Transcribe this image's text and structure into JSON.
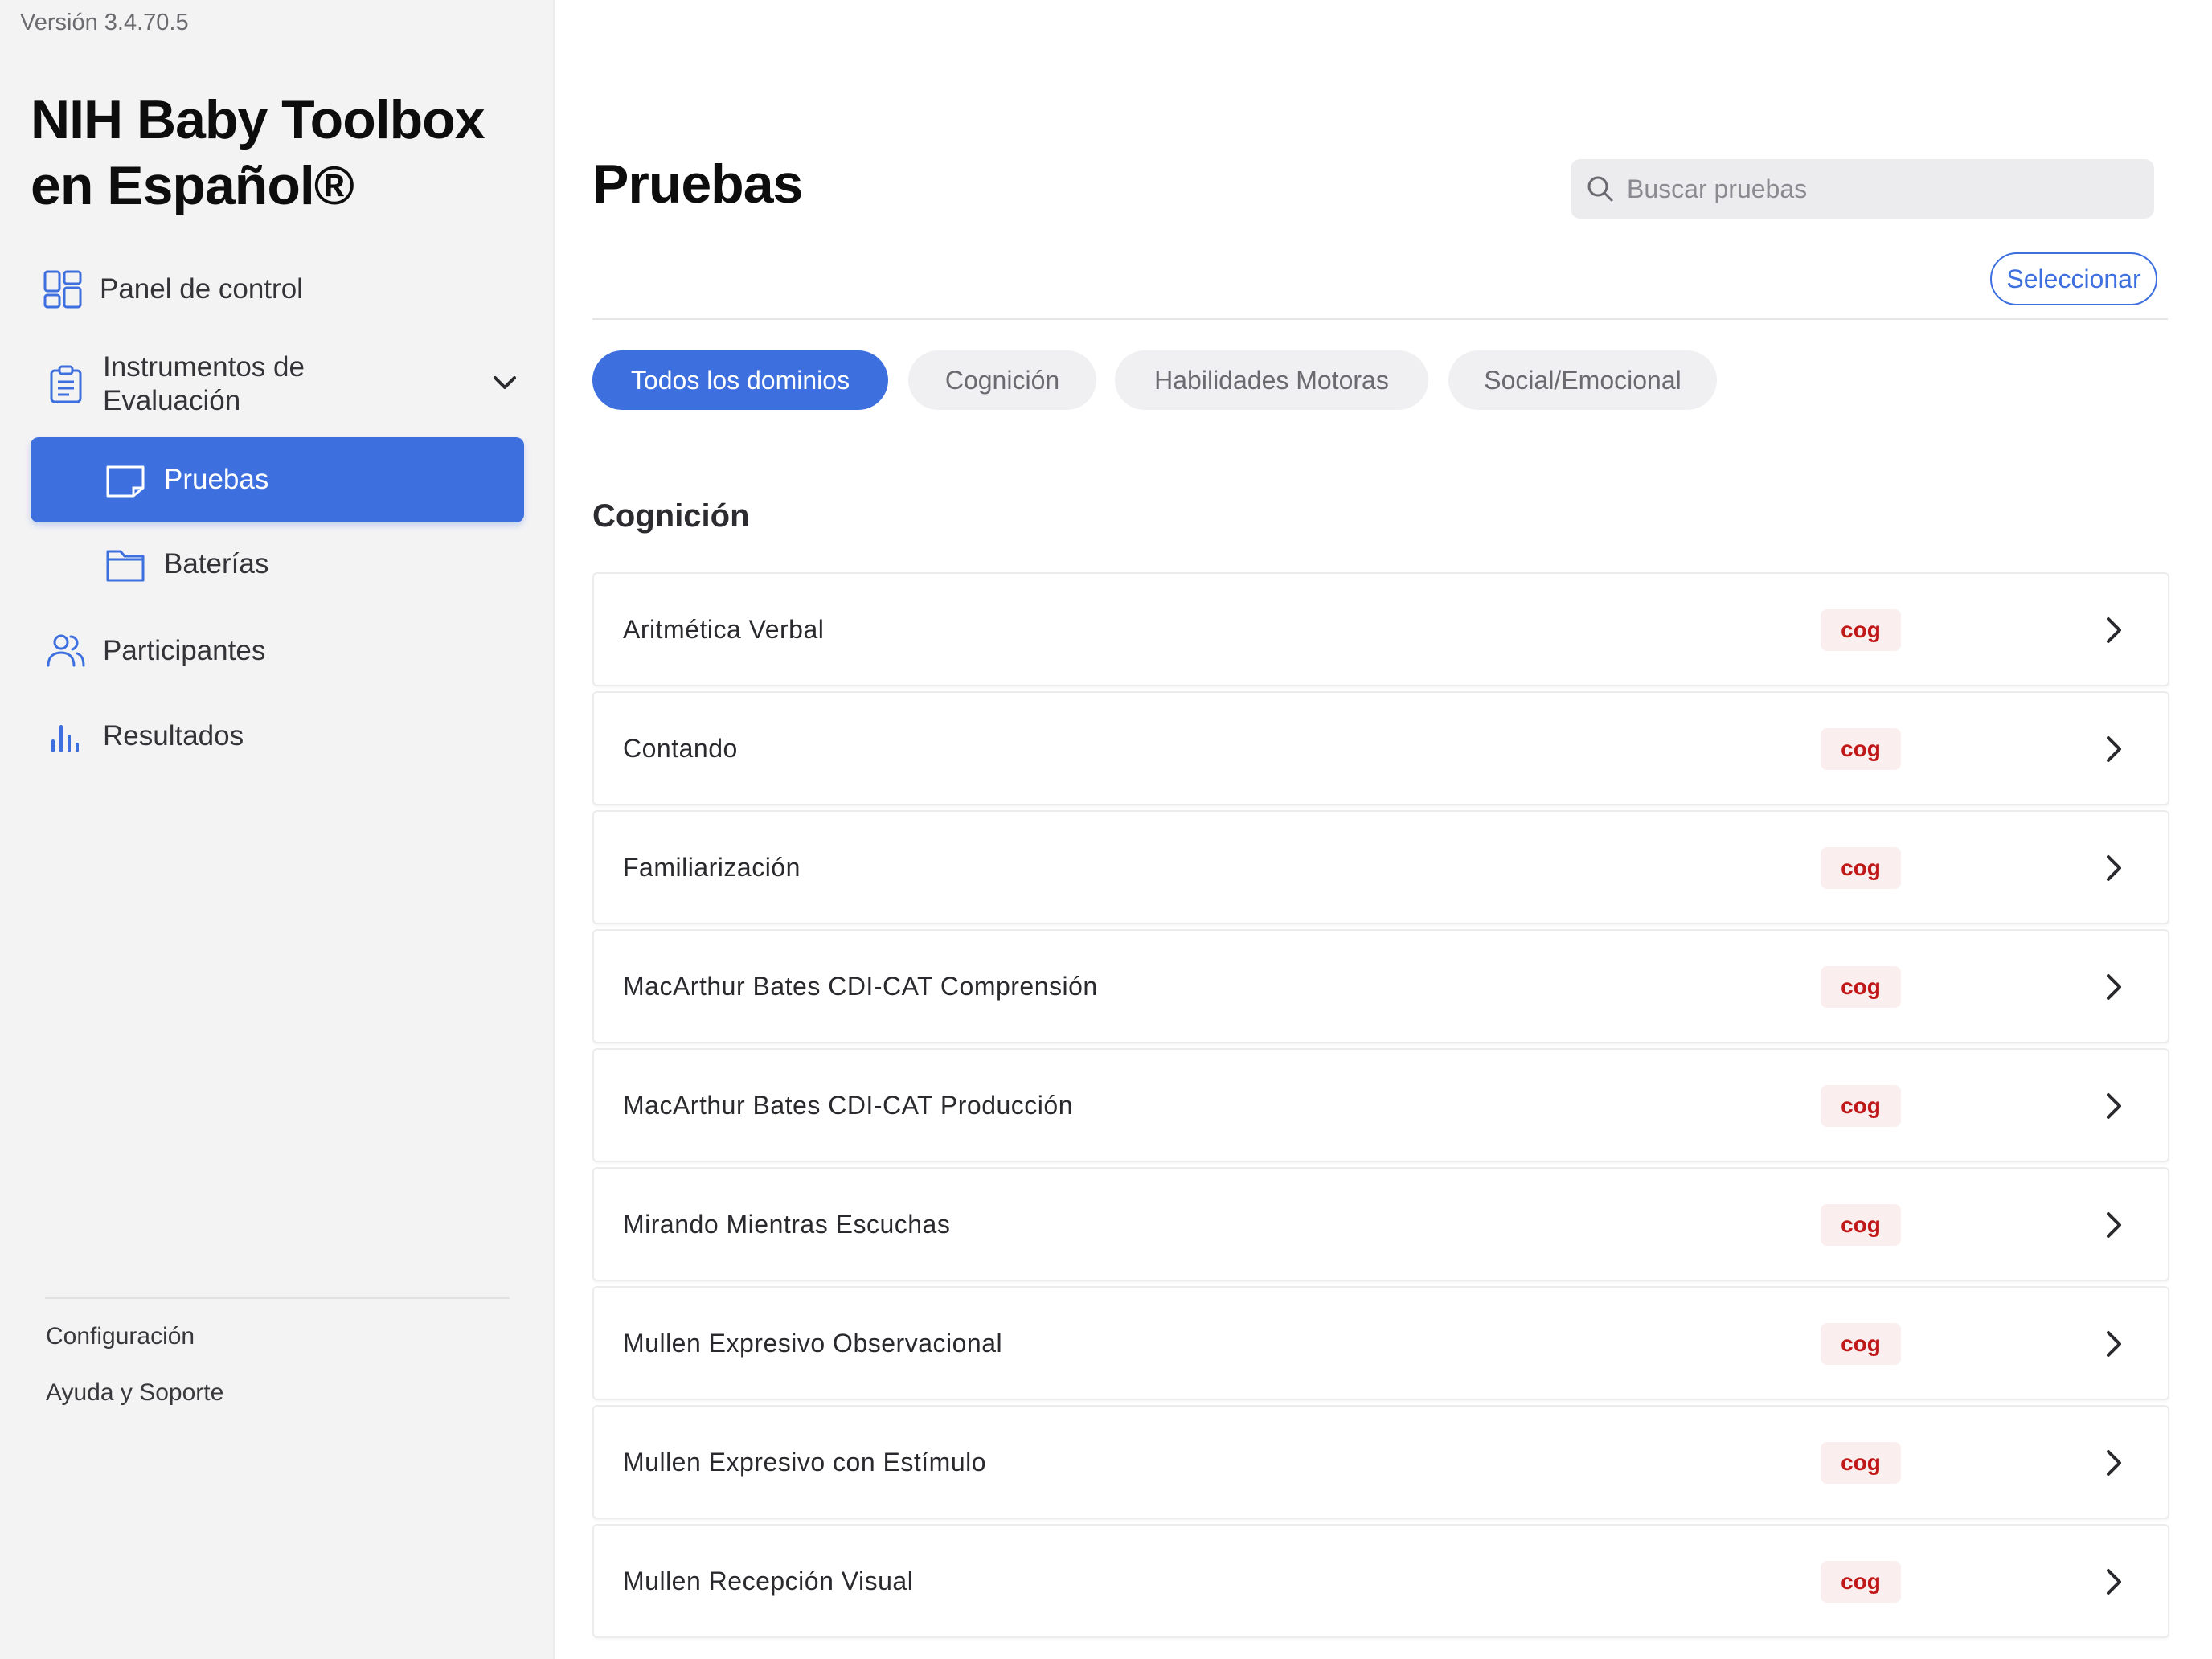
{
  "sidebar": {
    "version": "Versión 3.4.70.5",
    "app_title": "NIH Baby Toolbox en Español®",
    "nav": {
      "dashboard": "Panel de control",
      "instruments": "Instrumentos de Evaluación",
      "tests": "Pruebas",
      "batteries": "Baterías",
      "participants": "Participantes",
      "results": "Resultados"
    },
    "footer": {
      "settings": "Configuración",
      "help": "Ayuda y Soporte"
    }
  },
  "header": {
    "title": "Pruebas",
    "search_placeholder": "Buscar pruebas",
    "select_label": "Seleccionar"
  },
  "filters": [
    "Todos los dominios",
    "Cognición",
    "Habilidades Motoras",
    "Social/Emocional"
  ],
  "active_filter": "Todos los dominios",
  "section": {
    "title": "Cognición",
    "items": [
      {
        "name": "Aritmética Verbal",
        "tag": "cog"
      },
      {
        "name": "Contando",
        "tag": "cog"
      },
      {
        "name": "Familiarización",
        "tag": "cog"
      },
      {
        "name": "MacArthur Bates CDI-CAT Comprensión",
        "tag": "cog"
      },
      {
        "name": "MacArthur Bates CDI-CAT Producción",
        "tag": "cog"
      },
      {
        "name": "Mirando Mientras Escuchas",
        "tag": "cog"
      },
      {
        "name": "Mullen Expresivo Observacional",
        "tag": "cog"
      },
      {
        "name": "Mullen Expresivo con Estímulo",
        "tag": "cog"
      },
      {
        "name": "Mullen Recepción Visual",
        "tag": "cog"
      }
    ]
  },
  "colors": {
    "accent": "#3d6fdf",
    "badge_text": "#c01818",
    "badge_bg": "#fbeeee",
    "sidebar_bg": "#f3f3f4"
  }
}
